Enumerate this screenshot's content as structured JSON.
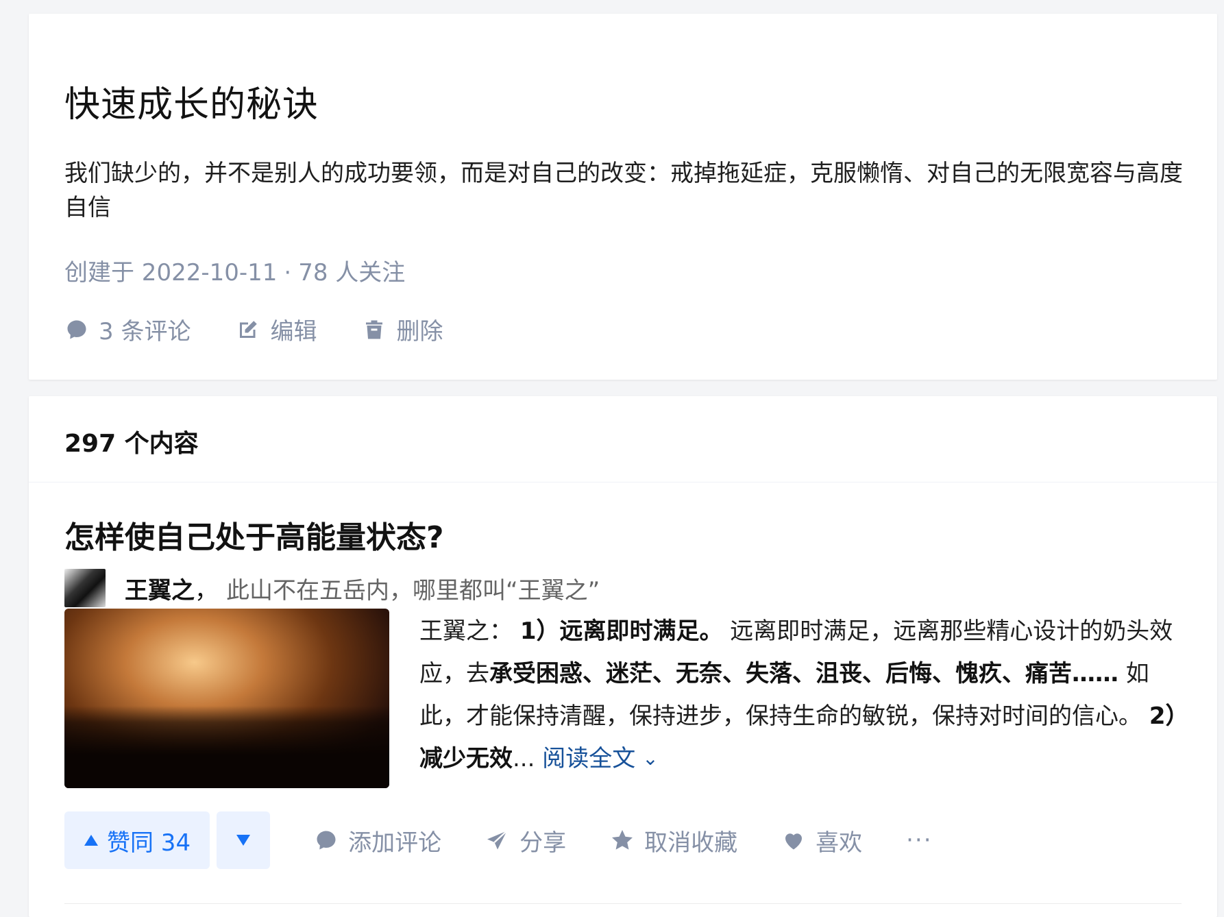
{
  "collection": {
    "title": "快速成长的秘诀",
    "description": "我们缺少的，并不是别人的成功要领，而是对自己的改变：戒掉拖延症，克服懒惰、对自己的无限宽容与高度自信",
    "created": "创建于 2022-10-11",
    "dot": "·",
    "followers": "78 人关注",
    "actions": {
      "comments": "3 条评论",
      "edit": "编辑",
      "delete": "删除"
    }
  },
  "content": {
    "count_label": "297 个内容",
    "item": {
      "title": "怎样使自己处于高能量状态?",
      "author_name": "王翼之",
      "author_sep": "，",
      "author_bio": "此山不在五岳内，哪里都叫“王翼之”",
      "excerpt_prefix": "王翼之： ",
      "excerpt_bold1": "1）远离即时满足。",
      "excerpt_mid1": " 远离即时满足，远离那些精心设计的奶头效应，去",
      "excerpt_bold2": "承受困惑、迷茫、无奈、失落、沮丧、后悔、愧疚、痛苦……",
      "excerpt_mid2": " 如此，才能保持清醒，保持进步，保持生命的敏锐，保持对时间的信心。 ",
      "excerpt_bold3": "2）减少无效",
      "excerpt_ellipsis": "...",
      "read_more": "阅读全文",
      "read_more_icon": "chevron-down-icon",
      "actions": {
        "upvote": "赞同 34",
        "comment": "添加评论",
        "share": "分享",
        "unfavorite": "取消收藏",
        "like": "喜欢",
        "more": "···"
      }
    }
  },
  "colors": {
    "accent": "#1772f6",
    "link": "#175199",
    "muted": "#8590a6"
  }
}
